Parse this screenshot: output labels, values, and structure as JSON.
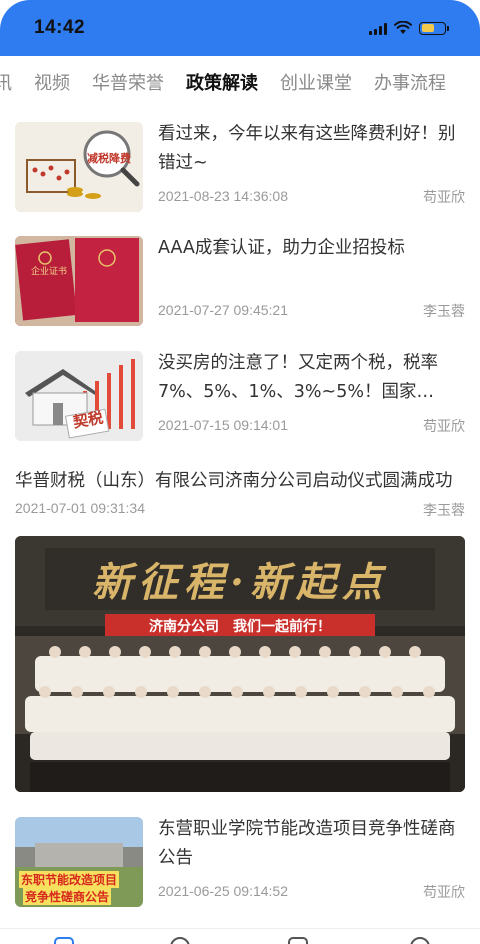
{
  "status_bar": {
    "time": "14:42"
  },
  "tabs": [
    {
      "label": "讯",
      "active": false
    },
    {
      "label": "视频",
      "active": false
    },
    {
      "label": "华普荣誉",
      "active": false
    },
    {
      "label": "政策解读",
      "active": true
    },
    {
      "label": "创业课堂",
      "active": false
    },
    {
      "label": "办事流程",
      "active": false
    }
  ],
  "news": [
    {
      "title": "看过来，今年以来有这些降费利好！别错过~",
      "date": "2021-08-23 14:36:08",
      "author": "苟亚欣",
      "thumb_text": "减税降费"
    },
    {
      "title": "AAA成套认证，助力企业招投标",
      "date": "2021-07-27 09:45:21",
      "author": "李玉蓉",
      "thumb_text": "企业证书"
    },
    {
      "title": "没买房的注意了！又定两个税，税率7%、5%、1%、3%~5%！国家…",
      "date": "2021-07-15 09:14:01",
      "author": "苟亚欣",
      "thumb_text": "契税"
    }
  ],
  "featured": {
    "title": "华普财税（山东）有限公司济南分公司启动仪式圆满成功",
    "date": "2021-07-01 09:31:34",
    "author": "李玉蓉",
    "banner_big": "新征程·新起点",
    "banner_sub": "济南分公司　我们一起前行！"
  },
  "last_news": {
    "title": "东营职业学院节能改造项目竞争性磋商公告",
    "date": "2021-06-25 09:14:52",
    "author": "苟亚欣",
    "thumb_text_1": "东职节能改造项目",
    "thumb_text_2": "竞争性磋商公告"
  }
}
